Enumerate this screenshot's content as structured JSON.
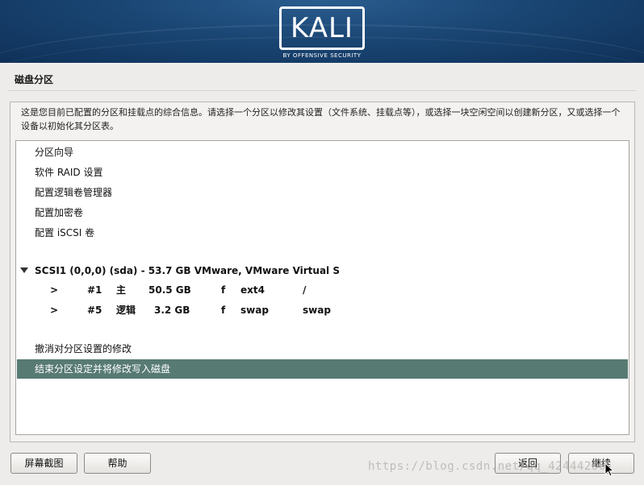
{
  "brand": {
    "logo_text": "KALI",
    "logo_subtitle": "BY OFFENSIVE SECURITY",
    "header_color": "#1a4674"
  },
  "page": {
    "title": "磁盘分区",
    "description": "这是您目前已配置的分区和挂载点的综合信息。请选择一个分区以修改其设置（文件系统、挂载点等），或选择一块空闲空间以创建新分区，又或选择一个设备以初始化其分区表。"
  },
  "menu_items": [
    "分区向导",
    "软件 RAID 设置",
    "配置逻辑卷管理器",
    "配置加密卷",
    "配置 iSCSI 卷"
  ],
  "disk": {
    "label": "SCSI1 (0,0,0) (sda) - 53.7 GB VMware, VMware Virtual S",
    "expanded_icon": "triangle-down-icon",
    "partitions": [
      {
        "marker": ">",
        "number": "#1",
        "type": "主",
        "size": "50.5 GB",
        "flag": "f",
        "fs": "ext4",
        "mount": "/"
      },
      {
        "marker": ">",
        "number": "#5",
        "type": "逻辑",
        "size": "3.2 GB",
        "flag": "f",
        "fs": "swap",
        "mount": "swap"
      }
    ]
  },
  "actions": {
    "undo": "撤消对分区设置的修改",
    "finish": "结束分区设定并将修改写入磁盘"
  },
  "selection_color": "#577a73",
  "buttons": {
    "screenshot": "屏幕截图",
    "help": "帮助",
    "back": "返回",
    "continue": "继续"
  },
  "watermark": "https://blog.csdn.net/qq_42444206"
}
